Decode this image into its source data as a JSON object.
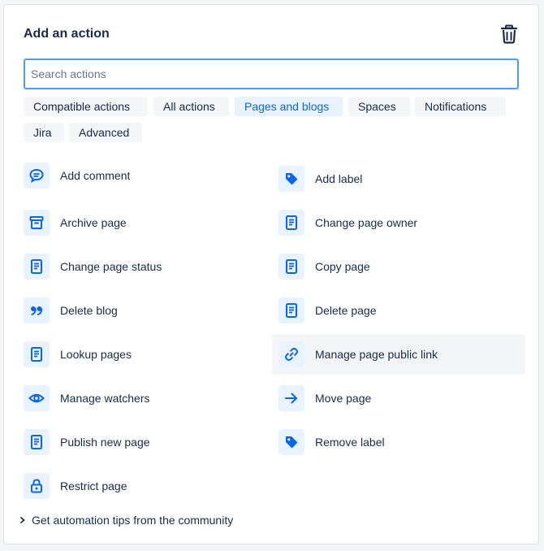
{
  "header": {
    "title": "Add an action"
  },
  "search": {
    "placeholder": "Search actions",
    "value": ""
  },
  "filters": [
    {
      "label": "Compatible actions",
      "selected": false
    },
    {
      "label": "All actions",
      "selected": false
    },
    {
      "label": "Pages and blogs",
      "selected": true
    },
    {
      "label": "Spaces",
      "selected": false
    },
    {
      "label": "Notifications",
      "selected": false
    },
    {
      "label": "Jira",
      "selected": false
    },
    {
      "label": "Advanced",
      "selected": false
    }
  ],
  "actions": [
    {
      "label": "Add comment",
      "icon": "comment-icon"
    },
    {
      "label": "Add label",
      "icon": "tag-icon"
    },
    {
      "label": "Archive page",
      "icon": "archive-icon"
    },
    {
      "label": "Change page owner",
      "icon": "page-icon"
    },
    {
      "label": "Change page status",
      "icon": "page-icon"
    },
    {
      "label": "Copy page",
      "icon": "page-icon"
    },
    {
      "label": "Delete blog",
      "icon": "quote-icon"
    },
    {
      "label": "Delete page",
      "icon": "page-icon"
    },
    {
      "label": "Lookup pages",
      "icon": "page-icon"
    },
    {
      "label": "Manage page public link",
      "icon": "link-icon"
    },
    {
      "label": "Manage watchers",
      "icon": "eye-icon"
    },
    {
      "label": "Move page",
      "icon": "arrow-right-icon"
    },
    {
      "label": "Publish new page",
      "icon": "page-icon"
    },
    {
      "label": "Remove label",
      "icon": "tag-icon"
    },
    {
      "label": "Restrict page",
      "icon": "lock-icon"
    }
  ],
  "tips": {
    "label": "Get automation tips from the community"
  },
  "colors": {
    "accent": "#0c66e4",
    "icon_bg": "#e9f2ff",
    "chip_bg": "#f4f5f7",
    "focus_border": "#4c9aff",
    "text": "#172b4d"
  }
}
